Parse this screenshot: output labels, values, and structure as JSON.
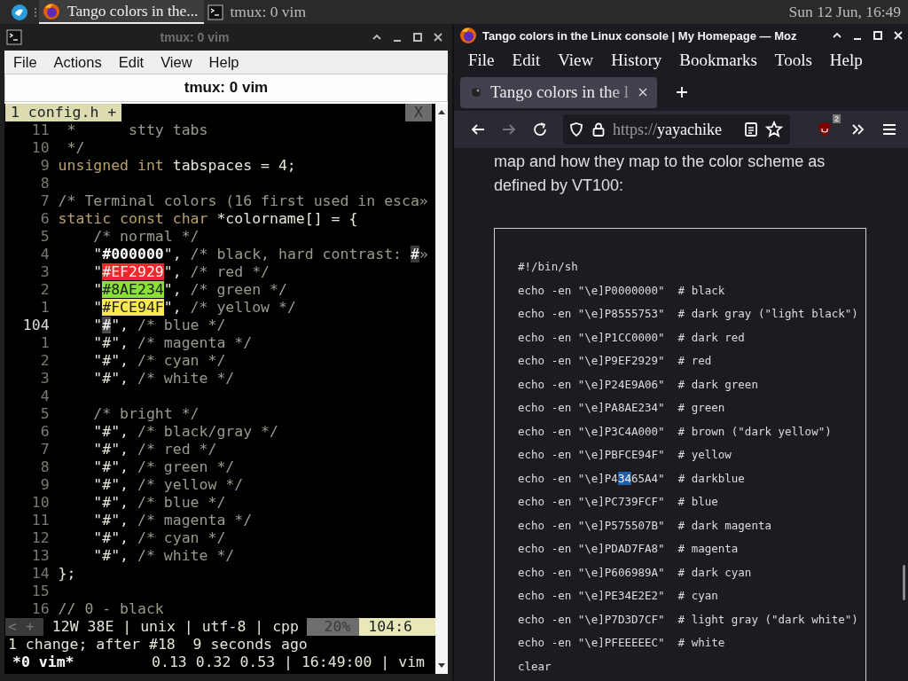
{
  "panel": {
    "tasks": [
      {
        "kind": "browser",
        "label": "Tango colors in the...",
        "selected": true
      },
      {
        "kind": "terminal",
        "label": "tmux: 0 vim",
        "selected": false
      }
    ],
    "clock": "Sun 12 Jun, 16:49"
  },
  "terminal_window": {
    "title": "tmux: 0 vim",
    "menu": [
      "File",
      "Actions",
      "Edit",
      "View",
      "Help"
    ],
    "tab_title": "tmux: 0 vim",
    "vim": {
      "tabline": {
        "tab": "1 config.h +",
        "close": "X"
      },
      "lines": [
        {
          "num": "11",
          "current": false,
          "segments": [
            {
              "text": " *      stty tabs",
              "kind": "comment"
            }
          ]
        },
        {
          "num": "10",
          "current": false,
          "segments": [
            {
              "text": " */",
              "kind": "comment"
            }
          ]
        },
        {
          "num": "9",
          "current": false,
          "segments": [
            {
              "text": "unsigned int",
              "kind": "type"
            },
            {
              "text": " tabspaces = 4;",
              "kind": "plain"
            }
          ]
        },
        {
          "num": "8",
          "current": false
        },
        {
          "num": "7",
          "current": false,
          "segments": [
            {
              "text": "/* Terminal colors (16 first used in esca»",
              "kind": "comment"
            }
          ]
        },
        {
          "num": "6",
          "current": false,
          "segments": [
            {
              "text": "static const char",
              "kind": "type"
            },
            {
              "text": " *colorname[] = {",
              "kind": "plain"
            }
          ]
        },
        {
          "num": "5",
          "current": false,
          "segments": [
            {
              "text": "    /* normal */",
              "kind": "comment"
            }
          ]
        },
        {
          "num": "4",
          "current": false,
          "segments": [
            {
              "text": "    \"",
              "kind": "plain"
            },
            {
              "text": "#000000",
              "kind": "value"
            },
            {
              "text": "\", ",
              "kind": "plain"
            },
            {
              "text": "/* black, hard contrast: ",
              "kind": "comment"
            },
            {
              "text": "#",
              "kind": "match"
            },
            {
              "text": "»",
              "kind": "comment"
            }
          ]
        },
        {
          "num": "3",
          "current": false,
          "segments": [
            {
              "text": "    \"",
              "kind": "plain"
            },
            {
              "text": "#EF2929",
              "kind": "swatch",
              "color": "#ef2929"
            },
            {
              "text": "\", ",
              "kind": "plain"
            },
            {
              "text": "/* red */",
              "kind": "comment"
            }
          ]
        },
        {
          "num": "2",
          "current": false,
          "segments": [
            {
              "text": "    \"",
              "kind": "plain"
            },
            {
              "text": "#8AE234",
              "kind": "swatch",
              "color": "#8ae234"
            },
            {
              "text": "\", ",
              "kind": "plain"
            },
            {
              "text": "/* green */",
              "kind": "comment"
            }
          ]
        },
        {
          "num": "1",
          "current": false,
          "segments": [
            {
              "text": "    \"",
              "kind": "plain"
            },
            {
              "text": "#FCE94F",
              "kind": "swatch",
              "color": "#fce94f"
            },
            {
              "text": "\", ",
              "kind": "plain"
            },
            {
              "text": "/* yellow */",
              "kind": "comment"
            }
          ]
        },
        {
          "num": "104",
          "current": true,
          "segments": [
            {
              "text": "    \"",
              "kind": "plain"
            },
            {
              "text": "#",
              "kind": "cursor"
            },
            {
              "text": "\", ",
              "kind": "plain"
            },
            {
              "text": "/* blue */",
              "kind": "comment"
            }
          ]
        },
        {
          "num": "1",
          "current": false,
          "segments": [
            {
              "text": "    \"#\", ",
              "kind": "plain"
            },
            {
              "text": "/* magenta */",
              "kind": "comment"
            }
          ]
        },
        {
          "num": "2",
          "current": false,
          "segments": [
            {
              "text": "    \"#\", ",
              "kind": "plain"
            },
            {
              "text": "/* cyan */",
              "kind": "comment"
            }
          ]
        },
        {
          "num": "3",
          "current": false,
          "segments": [
            {
              "text": "    \"#\", ",
              "kind": "plain"
            },
            {
              "text": "/* white */",
              "kind": "comment"
            }
          ]
        },
        {
          "num": "4",
          "current": false
        },
        {
          "num": "5",
          "current": false,
          "segments": [
            {
              "text": "    /* bright */",
              "kind": "comment"
            }
          ]
        },
        {
          "num": "6",
          "current": false,
          "segments": [
            {
              "text": "    \"#\", ",
              "kind": "plain"
            },
            {
              "text": "/* black/gray */",
              "kind": "comment"
            }
          ]
        },
        {
          "num": "7",
          "current": false,
          "segments": [
            {
              "text": "    \"#\", ",
              "kind": "plain"
            },
            {
              "text": "/* red */",
              "kind": "comment"
            }
          ]
        },
        {
          "num": "8",
          "current": false,
          "segments": [
            {
              "text": "    \"#\", ",
              "kind": "plain"
            },
            {
              "text": "/* green */",
              "kind": "comment"
            }
          ]
        },
        {
          "num": "9",
          "current": false,
          "segments": [
            {
              "text": "    \"#\", ",
              "kind": "plain"
            },
            {
              "text": "/* yellow */",
              "kind": "comment"
            }
          ]
        },
        {
          "num": "10",
          "current": false,
          "segments": [
            {
              "text": "    \"#\", ",
              "kind": "plain"
            },
            {
              "text": "/* blue */",
              "kind": "comment"
            }
          ]
        },
        {
          "num": "11",
          "current": false,
          "segments": [
            {
              "text": "    \"#\", ",
              "kind": "plain"
            },
            {
              "text": "/* magenta */",
              "kind": "comment"
            }
          ]
        },
        {
          "num": "12",
          "current": false,
          "segments": [
            {
              "text": "    \"#\", ",
              "kind": "plain"
            },
            {
              "text": "/* cyan */",
              "kind": "comment"
            }
          ]
        },
        {
          "num": "13",
          "current": false,
          "segments": [
            {
              "text": "    \"#\", ",
              "kind": "plain"
            },
            {
              "text": "/* white */",
              "kind": "comment"
            }
          ]
        },
        {
          "num": "14",
          "current": false,
          "segments": [
            {
              "text": "};",
              "kind": "plain"
            }
          ]
        },
        {
          "num": "15",
          "current": false
        },
        {
          "num": "16",
          "current": false,
          "segments": [
            {
              "text": "// 0 - black",
              "kind": "comment"
            }
          ]
        }
      ],
      "statusline": {
        "left": "< +",
        "info": "12W 38E | unix | utf-8 | cpp",
        "percent": "20%",
        "position": "104:6"
      },
      "message": "1 change; after #18  9 seconds ago"
    },
    "tmux_status": {
      "session": "*0 vim*",
      "right": "0.13 0.32 0.53 | 16:49:00 | vim"
    }
  },
  "browser_window": {
    "title": "Tango colors in the Linux console | My Homepage — Moz",
    "menu": [
      "File",
      "Edit",
      "View",
      "History",
      "Bookmarks",
      "Tools",
      "Help"
    ],
    "tab": {
      "title": "Tango colors in the l",
      "selected": true
    },
    "url": {
      "scheme": "https://",
      "host": "yayachike"
    },
    "extension_badge": "2",
    "paragraph": "map and how they map to the color scheme as defined by VT100:",
    "code": [
      {
        "text": "#!/bin/sh"
      },
      {
        "text": "echo -en \"\\e]P0000000\"  # black"
      },
      {
        "text": "echo -en \"\\e]P8555753\"  # dark gray (\"light black\")"
      },
      {
        "text": "echo -en \"\\e]P1CC0000\"  # dark red"
      },
      {
        "text": "echo -en \"\\e]P9EF2929\"  # red"
      },
      {
        "text": "echo -en \"\\e]P24E9A06\"  # dark green"
      },
      {
        "text": "echo -en \"\\e]PA8AE234\"  # green"
      },
      {
        "text": "echo -en \"\\e]P3C4A000\"  # brown (\"dark yellow\")"
      },
      {
        "text": "echo -en \"\\e]PBFCE94F\"  # yellow"
      },
      {
        "segments": [
          {
            "text": "echo -en \"\\e]P4",
            "selected": false
          },
          {
            "text": "34",
            "selected": true
          },
          {
            "text": "65A4\"  # darkblue",
            "selected": false
          }
        ]
      },
      {
        "text": "echo -en \"\\e]PC739FCF\"  # blue"
      },
      {
        "text": "echo -en \"\\e]P575507B\"  # dark magenta"
      },
      {
        "text": "echo -en \"\\e]PDAD7FA8\"  # magenta"
      },
      {
        "text": "echo -en \"\\e]P606989A\"  # dark cyan"
      },
      {
        "text": "echo -en \"\\e]PE34E2E2\"  # cyan"
      },
      {
        "text": "echo -en \"\\e]P7D3D7CF\"  # light gray (\"dark white\")"
      },
      {
        "text": "echo -en \"\\e]PFEEEEEC\"  # white"
      },
      {
        "text": "clear"
      }
    ]
  }
}
